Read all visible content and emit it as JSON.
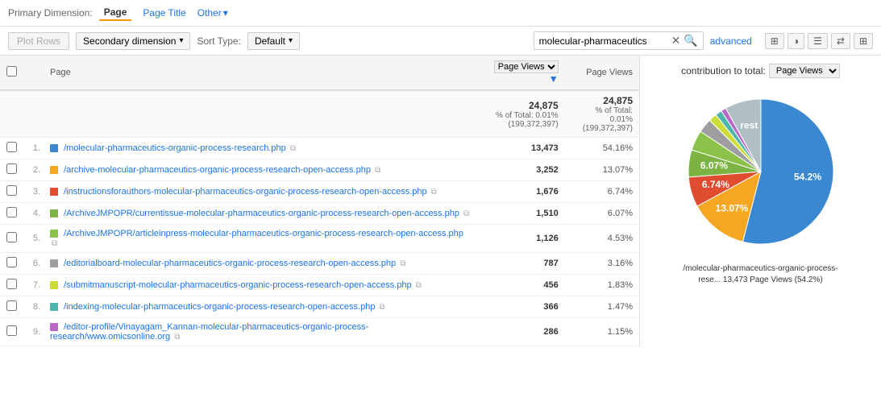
{
  "primaryDim": {
    "label": "Primary Dimension:",
    "tabs": [
      "Page",
      "Page Title",
      "Other"
    ]
  },
  "toolbar": {
    "plotRows": "Plot Rows",
    "secondaryDimension": "Secondary dimension",
    "sortTypeLabel": "Sort Type:",
    "sortDefault": "Default",
    "searchValue": "molecular-pharmaceutics",
    "advancedLabel": "advanced"
  },
  "table": {
    "headers": [
      "Page",
      "Page Views",
      "Page Views"
    ],
    "summaryPageViews": "24,875",
    "summaryPctOfTotal": "% of Total: 0.01%",
    "summaryTotal": "(199,372,397)",
    "summaryPageViews2": "24,875",
    "summaryPctOfTotal2": "% of Total: 0.01%",
    "summaryTotal2": "(199,372,397)",
    "rows": [
      {
        "num": 1,
        "color": "#3a87d2",
        "page": "/molecular-pharmaceutics-organic-process-research.php",
        "pageViews": "13,473",
        "pct": "54.16%"
      },
      {
        "num": 2,
        "color": "#f5a623",
        "page": "/archive-molecular-pharmaceutics-organic-process-research-open-access.php",
        "pageViews": "3,252",
        "pct": "13.07%"
      },
      {
        "num": 3,
        "color": "#e04c2f",
        "page": "/instructionsforauthors-molecular-pharmaceutics-organic-process-research-open-access.php",
        "pageViews": "1,676",
        "pct": "6.74%"
      },
      {
        "num": 4,
        "color": "#7cb342",
        "page": "/ArchiveJMPOPR/currentissue-molecular-pharmaceutics-organic-process-research-open-access.php",
        "pageViews": "1,510",
        "pct": "6.07%"
      },
      {
        "num": 5,
        "color": "#8bc34a",
        "page": "/ArchiveJMPOPR/articleinpress-molecular-pharmaceutics-organic-process-research-open-access.php",
        "pageViews": "1,126",
        "pct": "4.53%"
      },
      {
        "num": 6,
        "color": "#9e9e9e",
        "page": "/editorialboard-molecular-pharmaceutics-organic-process-research-open-access.php",
        "pageViews": "787",
        "pct": "3.16%"
      },
      {
        "num": 7,
        "color": "#cddc39",
        "page": "/submitmanuscript-molecular-pharmaceutics-organic-process-research-open-access.php",
        "pageViews": "456",
        "pct": "1.83%"
      },
      {
        "num": 8,
        "color": "#4db6ac",
        "page": "/indexing-molecular-pharmaceutics-organic-process-research-open-access.php",
        "pageViews": "366",
        "pct": "1.47%"
      },
      {
        "num": 9,
        "color": "#ba68c8",
        "page": "/editor-profile/Vinayagam_Kannan-molecular-pharmaceutics-organic-process-research/www.omicsonline.org",
        "pageViews": "286",
        "pct": "1.15%"
      }
    ]
  },
  "chart": {
    "headerLabel": "contribution to total:",
    "selectValue": "Page Views",
    "tooltip": "/molecular-pharmaceutics-organic-process-rese...\n13,473 Page Views (54.2%)",
    "segments": [
      {
        "label": "54.2%",
        "color": "#3a87d2",
        "pct": 54.2,
        "startAngle": 0
      },
      {
        "label": "13.07%",
        "color": "#f5a623",
        "pct": 13.07
      },
      {
        "label": "6.74%",
        "color": "#e04c2f",
        "pct": 6.74
      },
      {
        "label": "6.07%",
        "color": "#7cb342",
        "pct": 6.07
      },
      {
        "label": "4.53%",
        "color": "#8bc34a",
        "pct": 4.53
      },
      {
        "label": "3.16%",
        "color": "#9e9e9e",
        "pct": 3.16
      },
      {
        "label": "1.83%",
        "color": "#cddc39",
        "pct": 1.83
      },
      {
        "label": "1.47%",
        "color": "#4db6ac",
        "pct": 1.47
      },
      {
        "label": "1.15%",
        "color": "#ba68c8",
        "pct": 1.15
      },
      {
        "label": "rest",
        "color": "#b0bec5",
        "pct": 8.09
      }
    ]
  }
}
